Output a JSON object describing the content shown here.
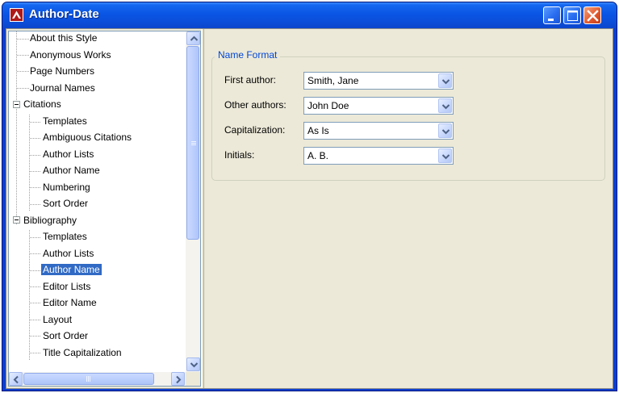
{
  "window": {
    "title": "Author-Date",
    "icon": "app-logo-icon",
    "controls": [
      "minimize-icon",
      "maximize-icon",
      "close-icon"
    ]
  },
  "tree": {
    "items": [
      {
        "label": "About this Style",
        "level": 1
      },
      {
        "label": "Anonymous Works",
        "level": 1
      },
      {
        "label": "Page Numbers",
        "level": 1
      },
      {
        "label": "Journal Names",
        "level": 1
      },
      {
        "label": "Citations",
        "level": 0,
        "expanded": true
      },
      {
        "label": "Templates",
        "level": 2
      },
      {
        "label": "Ambiguous Citations",
        "level": 2
      },
      {
        "label": "Author Lists",
        "level": 2
      },
      {
        "label": "Author Name",
        "level": 2
      },
      {
        "label": "Numbering",
        "level": 2
      },
      {
        "label": "Sort Order",
        "level": 2
      },
      {
        "label": "Bibliography",
        "level": 0,
        "expanded": true
      },
      {
        "label": "Templates",
        "level": 2
      },
      {
        "label": "Author Lists",
        "level": 2
      },
      {
        "label": "Author Name",
        "level": 2,
        "selected": true
      },
      {
        "label": "Editor Lists",
        "level": 2
      },
      {
        "label": "Editor Name",
        "level": 2
      },
      {
        "label": "Layout",
        "level": 2
      },
      {
        "label": "Sort Order",
        "level": 2
      },
      {
        "label": "Title Capitalization",
        "level": 2
      }
    ]
  },
  "name_format": {
    "legend": "Name Format",
    "fields": [
      {
        "label": "First author:",
        "value": "Smith, Jane"
      },
      {
        "label": "Other authors:",
        "value": "John Doe"
      },
      {
        "label": "Capitalization:",
        "value": "As Is"
      },
      {
        "label": "Initials:",
        "value": "A. B."
      }
    ]
  },
  "colors": {
    "selection": "#316ac5",
    "legend_text": "#0046d5",
    "title_bar": "#0b4fdb",
    "dialog_bg": "#ece9d8"
  }
}
